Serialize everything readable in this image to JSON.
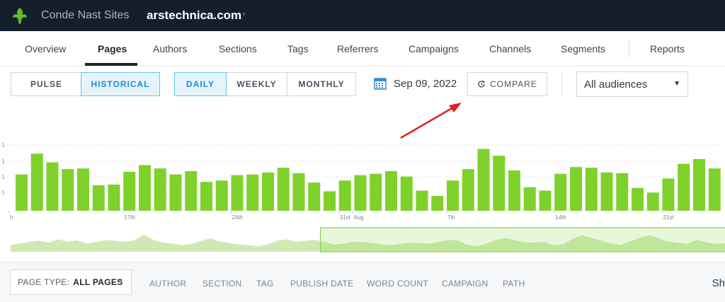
{
  "header": {
    "org_name": "Conde Nast Sites",
    "site_name": "arstechnica.com"
  },
  "nav": {
    "tabs": [
      {
        "label": "Overview"
      },
      {
        "label": "Pages"
      },
      {
        "label": "Authors"
      },
      {
        "label": "Sections"
      },
      {
        "label": "Tags"
      },
      {
        "label": "Referrers"
      },
      {
        "label": "Campaigns"
      },
      {
        "label": "Channels"
      },
      {
        "label": "Segments"
      },
      {
        "label": "Reports"
      }
    ],
    "active_tab": "Pages"
  },
  "toolbar": {
    "mode": {
      "pulse": "PULSE",
      "historical": "HISTORICAL",
      "selected": "HISTORICAL"
    },
    "interval": {
      "daily": "DAILY",
      "weekly": "WEEKLY",
      "monthly": "MONTHLY",
      "selected": "DAILY"
    },
    "date": "Sep 09, 2022",
    "compare_label": "COMPARE",
    "audience": "All audiences"
  },
  "chart_data": {
    "type": "bar",
    "color": "#7ed12b",
    "values": [
      54,
      85,
      72,
      62,
      63,
      38,
      39,
      58,
      68,
      63,
      54,
      59,
      43,
      45,
      53,
      54,
      57,
      64,
      56,
      42,
      29,
      45,
      53,
      55,
      59,
      51,
      30,
      22,
      45,
      62,
      92,
      82,
      60,
      35,
      30,
      55,
      65,
      64,
      57,
      56,
      34,
      27,
      48,
      70,
      77,
      63
    ],
    "x_tick_labels": [
      {
        "index": 0,
        "label": "h"
      },
      {
        "index": 7,
        "label": "17th"
      },
      {
        "index": 14,
        "label": "24th"
      },
      {
        "index": 21,
        "label": "31st"
      },
      {
        "index": 22,
        "label": "Aug"
      },
      {
        "index": 28,
        "label": "7th"
      },
      {
        "index": 35,
        "label": "14th"
      },
      {
        "index": 42,
        "label": "21st"
      }
    ],
    "y_tick_labels": [
      "1",
      "1",
      "1",
      "1"
    ]
  },
  "overview": {
    "area_values": [
      15,
      18,
      22,
      24,
      20,
      27,
      22,
      25,
      18,
      21,
      26,
      24,
      22,
      25,
      37,
      26,
      20,
      18,
      14,
      17,
      24,
      29,
      22,
      19,
      16,
      14,
      12,
      16,
      24,
      27,
      22,
      24,
      26,
      21,
      16,
      18,
      22,
      21,
      19,
      16,
      15,
      17,
      20,
      19,
      17,
      22,
      26,
      24,
      15,
      12,
      18,
      26,
      30,
      25,
      21,
      20,
      22,
      14,
      16,
      28,
      36,
      30,
      24,
      18,
      15,
      22,
      30,
      36,
      30,
      22,
      20,
      17,
      26,
      21,
      17,
      18
    ],
    "selected_range_fraction": [
      0.44,
      1.0
    ]
  },
  "filters": {
    "page_type_prefix": "PAGE TYPE:",
    "page_type_value": "ALL PAGES",
    "items": [
      "AUTHOR",
      "SECTION",
      "TAG",
      "PUBLISH DATE",
      "WORD COUNT",
      "CAMPAIGN",
      "PATH"
    ],
    "right_text": "Sh"
  },
  "icons": {
    "logo": "parsely-leaf-icon",
    "calendar": "calendar-icon",
    "compare": "refresh-clock-icon",
    "dropdown": "caret-down-icon"
  }
}
